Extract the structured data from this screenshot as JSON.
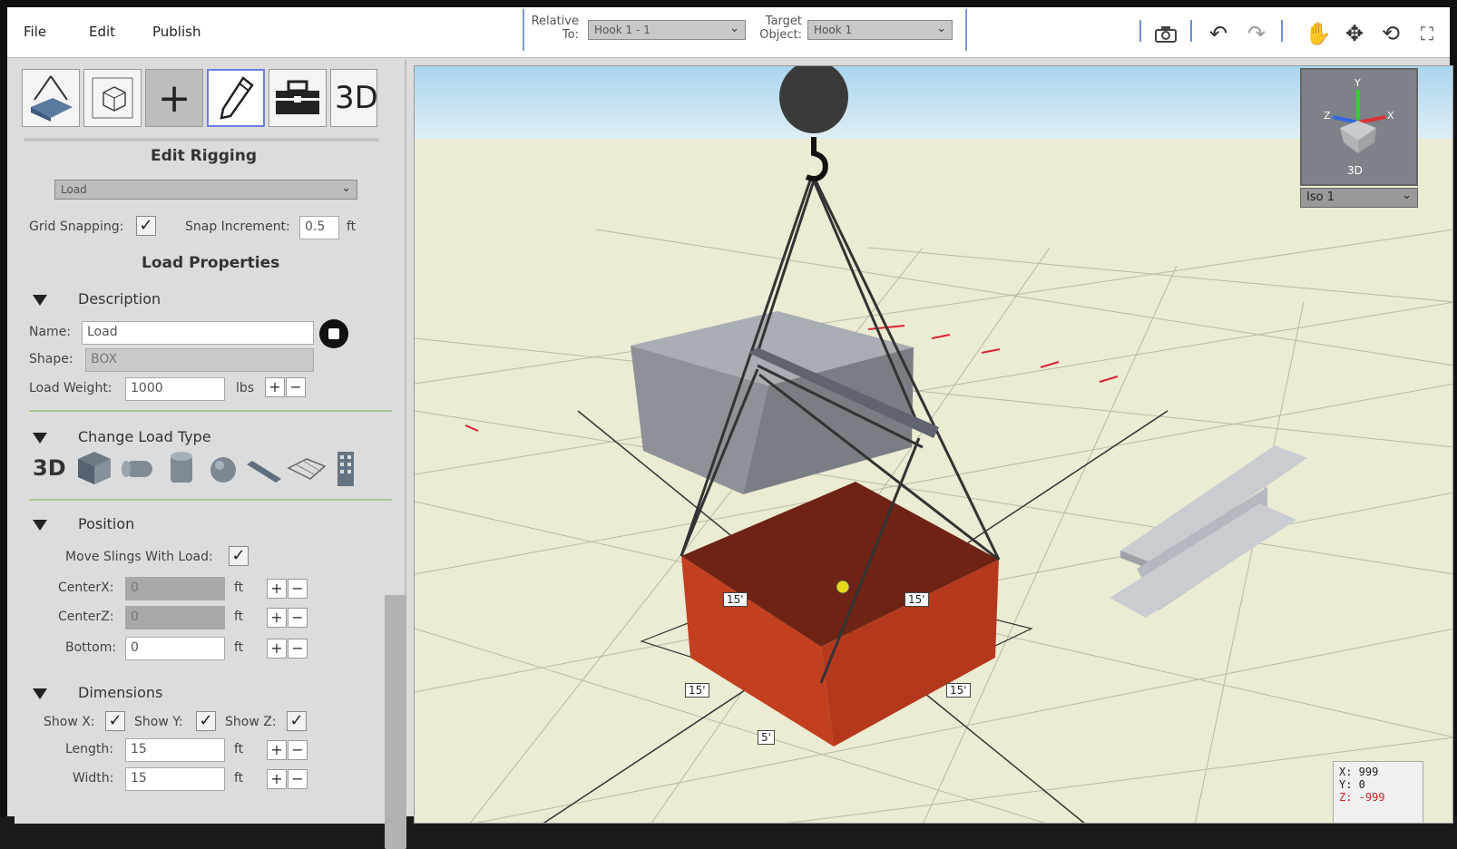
{
  "menu": {
    "file": "File",
    "edit": "Edit",
    "publish": "Publish"
  },
  "toolbar": {
    "relative_to_label": "Relative To:",
    "relative_to_value": "Hook 1 - 1",
    "target_object_label": "Target Object:",
    "target_object_value": "Hook 1",
    "icons": [
      "camera-icon",
      "undo-icon",
      "redo-icon",
      "hand-icon",
      "move-icon",
      "rotate-icon",
      "fullscreen-icon"
    ]
  },
  "left": {
    "tools": [
      "rigging-tool",
      "wireframe-tool",
      "add-tool",
      "edit-tool",
      "toolbox-tool",
      "3d-tool"
    ],
    "tool_3d_label": "3D",
    "title": "Edit Rigging",
    "object_select": "Load",
    "grid_snapping_label": "Grid Snapping:",
    "grid_snapping_checked": true,
    "snap_increment_label": "Snap Increment:",
    "snap_increment_value": "0.5",
    "snap_unit": "ft",
    "load_properties": "Load Properties",
    "description": {
      "title": "Description",
      "name_label": "Name:",
      "name_value": "Load",
      "shape_label": "Shape:",
      "shape_value": "BOX",
      "weight_label": "Load Weight:",
      "weight_value": "1000",
      "weight_unit": "lbs"
    },
    "change_load_type": {
      "title": "Change Load Type",
      "label_3d": "3D"
    },
    "position": {
      "title": "Position",
      "move_slings_label": "Move Slings With Load:",
      "move_slings_checked": true,
      "centerx_label": "CenterX:",
      "centerx_value": "0",
      "centerz_label": "CenterZ:",
      "centerz_value": "0",
      "bottom_label": "Bottom:",
      "bottom_value": "0",
      "unit": "ft"
    },
    "dimensions": {
      "title": "Dimensions",
      "show_x": "Show X:",
      "show_y": "Show Y:",
      "show_z": "Show Z:",
      "length_label": "Length:",
      "length_value": "15",
      "width_label": "Width:",
      "width_value": "15",
      "unit": "ft"
    }
  },
  "viewport": {
    "nav_label": "3D",
    "view_select": "Iso 1",
    "dim_labels": [
      "15'",
      "15'",
      "15'",
      "15'",
      "5'"
    ],
    "coords": {
      "x": "X: 999",
      "y": "Y: 0",
      "z": "Z: -999"
    },
    "colors": {
      "load": "#b4381c",
      "load_top": "#6e2315",
      "sky": "#b8dcf0",
      "ground": "#ecebd3"
    }
  }
}
